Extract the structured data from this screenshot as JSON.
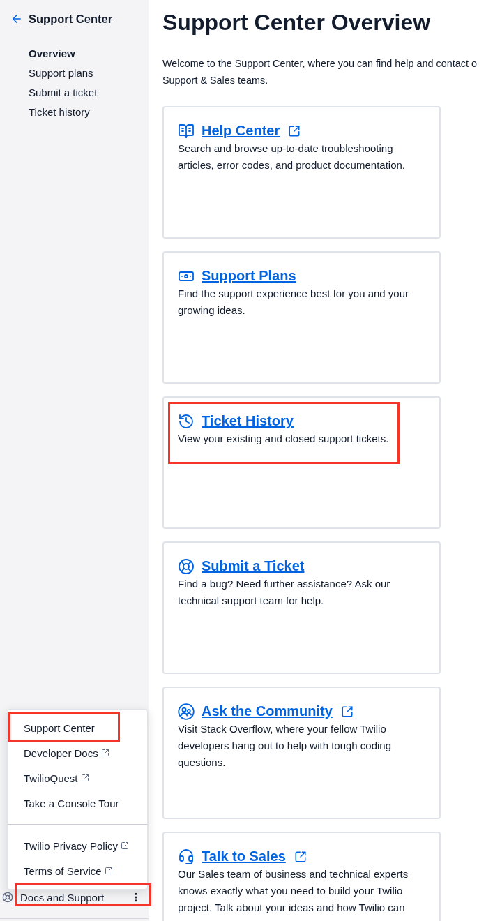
{
  "sidebar": {
    "back_title": "Support Center",
    "nav": [
      {
        "label": "Overview",
        "selected": true
      },
      {
        "label": "Support plans",
        "selected": false
      },
      {
        "label": "Submit a ticket",
        "selected": false
      },
      {
        "label": "Ticket history",
        "selected": false
      }
    ],
    "menu": {
      "groups": [
        [
          {
            "label": "Support Center",
            "external": false,
            "highlighted": true
          },
          {
            "label": "Developer Docs",
            "external": true,
            "highlighted": false
          },
          {
            "label": "TwilioQuest",
            "external": true,
            "highlighted": false
          },
          {
            "label": "Take a Console Tour",
            "external": false,
            "highlighted": false
          }
        ],
        [
          {
            "label": "Twilio Privacy Policy",
            "external": true,
            "highlighted": false
          },
          {
            "label": "Terms of Service",
            "external": true,
            "highlighted": false
          }
        ]
      ]
    },
    "footer": {
      "label": "Docs and Support",
      "highlighted": true
    }
  },
  "main": {
    "title": "Support Center Overview",
    "intro_lines": [
      "Welcome to the Support Center, where you can find help and contact o",
      "Support & Sales teams."
    ],
    "cards": [
      {
        "title": "Help Center",
        "external": true,
        "highlighted": false,
        "description": "Search and browse up-to-date troubleshooting articles, error codes, and product documentation."
      },
      {
        "title": "Support Plans",
        "external": false,
        "highlighted": false,
        "description": "Find the support experience best for you and your growing ideas."
      },
      {
        "title": "Ticket History",
        "external": false,
        "highlighted": true,
        "description": "View your existing and closed support tickets."
      },
      {
        "title": "Submit a Ticket",
        "external": false,
        "highlighted": false,
        "description": "Find a bug? Need further assistance? Ask our technical support team for help."
      },
      {
        "title": "Ask the Community",
        "external": true,
        "highlighted": false,
        "description": "Visit Stack Overflow, where your fellow Twilio developers hang out to help with tough coding questions."
      },
      {
        "title": "Talk to Sales",
        "external": true,
        "highlighted": false,
        "description": "Our Sales team of business and technical experts knows exactly what you need to build your Twilio project. Talk about your ideas and how Twilio can"
      }
    ]
  }
}
